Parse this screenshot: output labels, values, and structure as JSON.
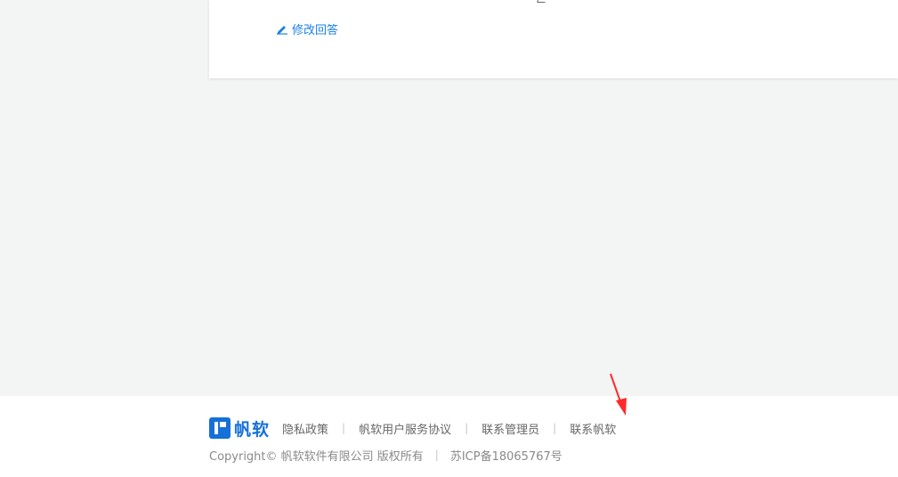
{
  "answer": {
    "edit_label": "修改回答"
  },
  "footer": {
    "logo_text": "帆软",
    "links": [
      "隐私政策",
      "帆软用户服务协议",
      "联系管理员",
      "联系帆软"
    ],
    "copyright": "Copyright© 帆软软件有限公司 版权所有",
    "icp": "苏ICP备18065767号"
  },
  "colors": {
    "accent": "#1a82e2",
    "brand": "#1570d8",
    "annotation_arrow": "#ff2a2a"
  },
  "icons": {
    "edit": "pencil-icon",
    "logo": "fanruan-logo-icon"
  }
}
